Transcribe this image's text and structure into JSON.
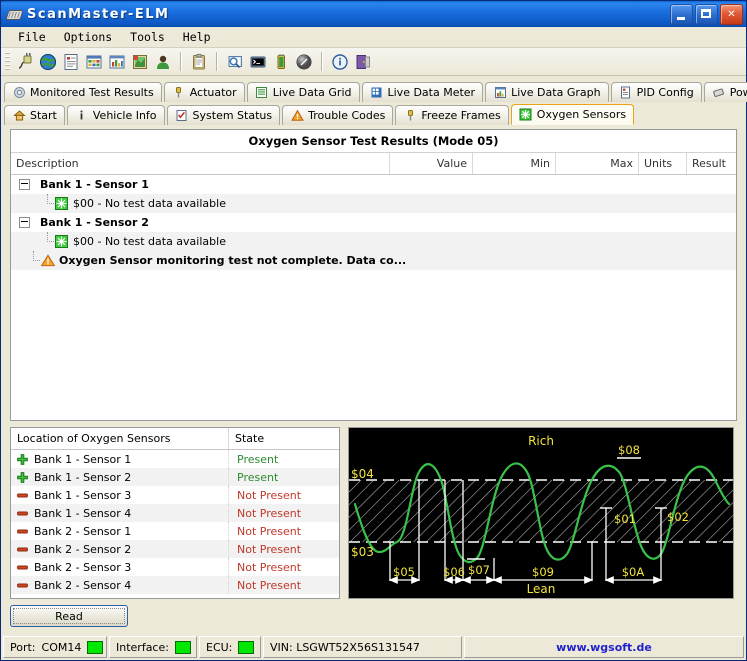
{
  "window": {
    "title": "ScanMaster-ELM",
    "icon": "chip-icon",
    "buttons": {
      "minimize": "minimize-button",
      "maximize": "maximize-button",
      "close": "close-button"
    }
  },
  "menu": {
    "items": [
      "File",
      "Options",
      "Tools",
      "Help"
    ]
  },
  "toolbar": {
    "icons": [
      "connect-icon",
      "globe-icon",
      "report-icon",
      "grid-icon",
      "bar-chart-icon",
      "graph-image-icon",
      "user-icon",
      "clipboard-icon",
      "search-monitor-icon",
      "terminal-icon",
      "battery-icon",
      "gauge-icon",
      "info-icon",
      "exit-icon"
    ]
  },
  "tabs": {
    "row1": [
      {
        "label": "Monitored Test Results",
        "icon": "gear-icon"
      },
      {
        "label": "Actuator",
        "icon": "actuator-icon"
      },
      {
        "label": "Live Data Grid",
        "icon": "list-icon"
      },
      {
        "label": "Live Data Meter",
        "icon": "meter-icon"
      },
      {
        "label": "Live Data Graph",
        "icon": "bar-chart-icon"
      },
      {
        "label": "PID Config",
        "icon": "pid-icon"
      },
      {
        "label": "Power",
        "icon": "power-icon"
      }
    ],
    "row2": [
      {
        "label": "Start",
        "icon": "home-icon"
      },
      {
        "label": "Vehicle Info",
        "icon": "info-icon"
      },
      {
        "label": "System Status",
        "icon": "checklist-icon"
      },
      {
        "label": "Trouble Codes",
        "icon": "warning-icon"
      },
      {
        "label": "Freeze Frames",
        "icon": "actuator-icon"
      },
      {
        "label": "Oxygen Sensors",
        "icon": "o2-icon",
        "selected": true
      }
    ]
  },
  "results": {
    "title": "Oxygen Sensor Test Results (Mode 05)",
    "columns": [
      "Description",
      "Value",
      "Min",
      "Max",
      "Units",
      "Result"
    ],
    "rows": [
      {
        "type": "group",
        "label": "Bank 1 - Sensor 1",
        "expander": "minus",
        "value": "",
        "min": "",
        "max": "",
        "units": "",
        "result": ""
      },
      {
        "type": "child",
        "label": "$00 - No test data available",
        "icon": "o2-icon",
        "value": "",
        "min": "",
        "max": "",
        "units": "",
        "result": ""
      },
      {
        "type": "group",
        "label": "Bank 1 - Sensor 2",
        "expander": "minus",
        "value": "",
        "min": "",
        "max": "",
        "units": "",
        "result": ""
      },
      {
        "type": "child",
        "label": "$00 - No test data available",
        "icon": "o2-icon",
        "value": "",
        "min": "",
        "max": "",
        "units": "",
        "result": ""
      },
      {
        "type": "warning",
        "label": "Oxygen Sensor monitoring test not complete. Data co...",
        "icon": "warning-icon",
        "value": "",
        "min": "",
        "max": "",
        "units": "",
        "result": ""
      }
    ]
  },
  "locations": {
    "columns": [
      "Location of Oxygen Sensors",
      "State"
    ],
    "rows": [
      {
        "name": "Bank 1 - Sensor 1",
        "state": "Present",
        "icon": "plus-icon"
      },
      {
        "name": "Bank 1 - Sensor 2",
        "state": "Present",
        "icon": "plus-icon"
      },
      {
        "name": "Bank 1 - Sensor 3",
        "state": "Not Present",
        "icon": "minus-icon"
      },
      {
        "name": "Bank 1 - Sensor 4",
        "state": "Not Present",
        "icon": "minus-icon"
      },
      {
        "name": "Bank 2 - Sensor 1",
        "state": "Not Present",
        "icon": "minus-icon"
      },
      {
        "name": "Bank 2 - Sensor 2",
        "state": "Not Present",
        "icon": "minus-icon"
      },
      {
        "name": "Bank 2 - Sensor 3",
        "state": "Not Present",
        "icon": "minus-icon"
      },
      {
        "name": "Bank 2 - Sensor 4",
        "state": "Not Present",
        "icon": "minus-icon"
      }
    ]
  },
  "diagram": {
    "name": "oxygen-sensor-waveform-diagram",
    "top_label": "Rich",
    "bottom_label": "Lean",
    "threshold_high": "$04",
    "threshold_low": "$03",
    "markers": [
      "$01",
      "$02",
      "$05",
      "$06",
      "$07",
      "$08",
      "$09",
      "$0A"
    ],
    "colors": {
      "background": "#000000",
      "wave": "#39c24a",
      "label": "#f2e43c",
      "line": "#ffffff"
    }
  },
  "read_button": {
    "label": "Read"
  },
  "status": {
    "port_label": "Port:",
    "port_value": "COM14",
    "interface_label": "Interface:",
    "ecu_label": "ECU:",
    "vin": "VIN: LSGWT52X56S131547",
    "website": "www.wgsoft.de"
  }
}
